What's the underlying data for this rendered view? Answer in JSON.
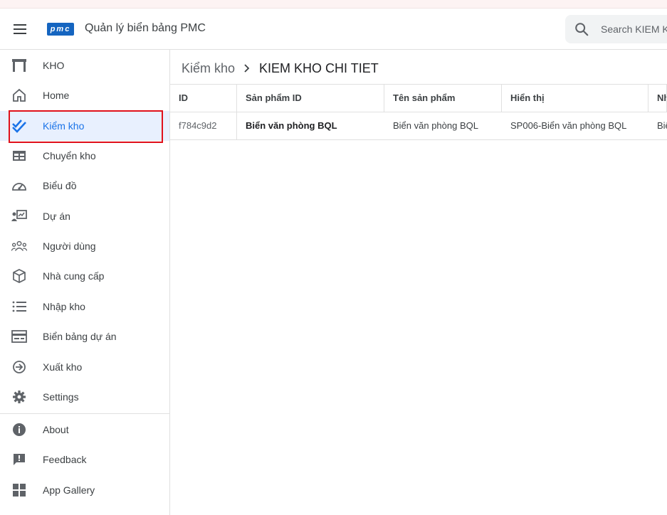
{
  "app": {
    "title": "Quản lý biển bảng PMC",
    "logo_text": "pmc",
    "brand_color": "#1565c0"
  },
  "search": {
    "placeholder": "Search KIEM KHO CHI TIET"
  },
  "sidebar": {
    "items": [
      {
        "label": "KHO",
        "icon": "warehouse-icon"
      },
      {
        "label": "Home",
        "icon": "home-icon"
      },
      {
        "label": "Kiểm kho",
        "icon": "double-check-icon",
        "active": true
      },
      {
        "label": "Chuyển kho",
        "icon": "table-icon"
      },
      {
        "label": "Biểu đồ",
        "icon": "speedometer-icon"
      },
      {
        "label": "Dự án",
        "icon": "presentation-icon"
      },
      {
        "label": "Người dùng",
        "icon": "people-icon"
      },
      {
        "label": "Nhà cung cấp",
        "icon": "cube-icon"
      },
      {
        "label": "Nhập kho",
        "icon": "list-icon"
      },
      {
        "label": "Biển bảng dự án",
        "icon": "card-icon"
      },
      {
        "label": "Xuất kho",
        "icon": "arrow-circle-icon"
      },
      {
        "label": "Settings",
        "icon": "gear-icon"
      }
    ],
    "footer_items": [
      {
        "label": "About",
        "icon": "info-icon"
      },
      {
        "label": "Feedback",
        "icon": "feedback-icon"
      },
      {
        "label": "App Gallery",
        "icon": "grid-icon"
      }
    ]
  },
  "breadcrumb": {
    "parent": "Kiểm kho",
    "current": "KIEM KHO CHI TIET"
  },
  "table": {
    "columns": [
      "ID",
      "Sản phẩm ID",
      "Tên sản phẩm",
      "Hiển thị",
      "Nh"
    ],
    "rows": [
      [
        "f784c9d2",
        "Biển văn phòng BQL",
        "Biển văn phòng BQL",
        "SP006-Biển văn phòng BQL",
        "Biể"
      ]
    ]
  },
  "colors": {
    "active_bg": "#e8f0fe",
    "active_text": "#1a73e8",
    "highlight": "#e0111b"
  }
}
